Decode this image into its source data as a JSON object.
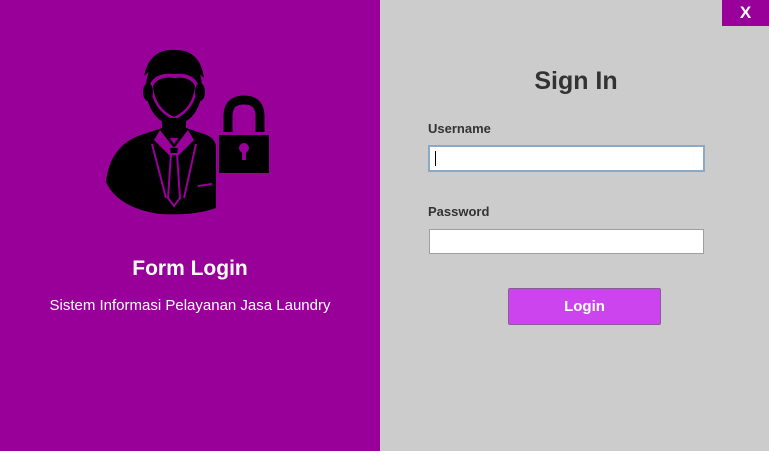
{
  "window": {
    "close_label": "X"
  },
  "left_panel": {
    "icon": "user-with-lock-icon",
    "title": "Form Login",
    "subtitle": "Sistem Informasi Pelayanan Jasa Laundry",
    "background": "#990099"
  },
  "sign_in": {
    "title": "Sign In",
    "username_label": "Username",
    "username_value": "",
    "password_label": "Password",
    "password_value": "",
    "login_label": "Login",
    "button_color": "#cc44ee",
    "background": "#cccccc"
  }
}
